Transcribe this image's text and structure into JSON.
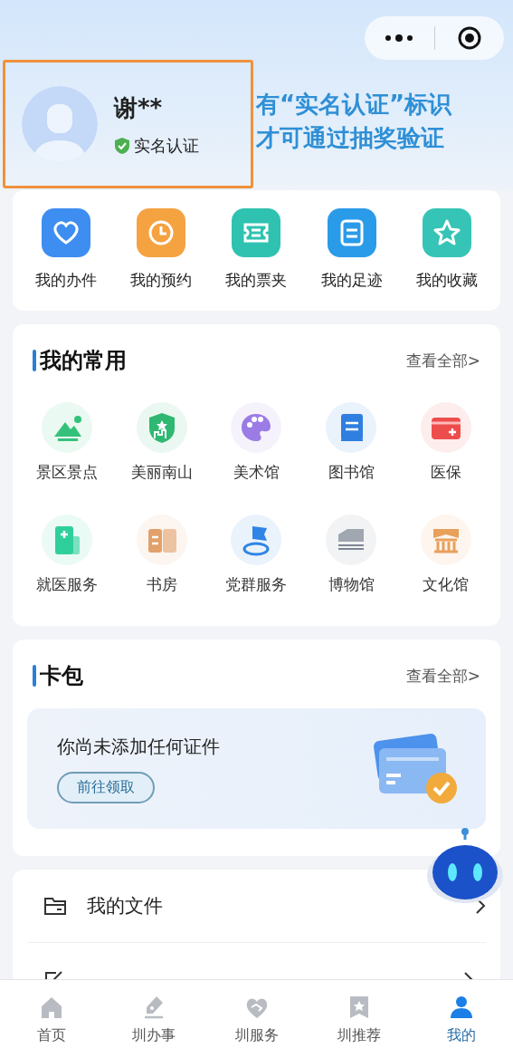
{
  "profile": {
    "name": "谢**",
    "verified": true,
    "badge": "实名认证"
  },
  "annotation": [
    "有“实名认证”标识",
    "才可通过抽奖验证"
  ],
  "quick_actions": [
    {
      "label": "我的办件",
      "color": "#3d8ef0"
    },
    {
      "label": "我的预约",
      "color": "#f5a241"
    },
    {
      "label": "我的票夹",
      "color": "#2fc2b0"
    },
    {
      "label": "我的足迹",
      "color": "#2a9be8"
    },
    {
      "label": "我的收藏",
      "color": "#35c4b5"
    }
  ],
  "common": {
    "title": "我的常用",
    "more": "查看全部>",
    "items": [
      {
        "label": "景区景点"
      },
      {
        "label": "美丽南山"
      },
      {
        "label": "美术馆"
      },
      {
        "label": "图书馆"
      },
      {
        "label": "医保"
      },
      {
        "label": "就医服务"
      },
      {
        "label": "书房"
      },
      {
        "label": "党群服务"
      },
      {
        "label": "博物馆"
      },
      {
        "label": "文化馆"
      }
    ]
  },
  "wallet": {
    "title": "卡包",
    "more": "查看全部>",
    "empty_text": "你尚未添加任何证件",
    "button": "前往领取"
  },
  "menu": [
    {
      "label": "我的文件"
    }
  ],
  "tabs": [
    {
      "label": "首页",
      "selected": false
    },
    {
      "label": "圳办事",
      "selected": false
    },
    {
      "label": "圳服务",
      "selected": false
    },
    {
      "label": "圳推荐",
      "selected": false
    },
    {
      "label": "我的",
      "selected": true
    }
  ]
}
